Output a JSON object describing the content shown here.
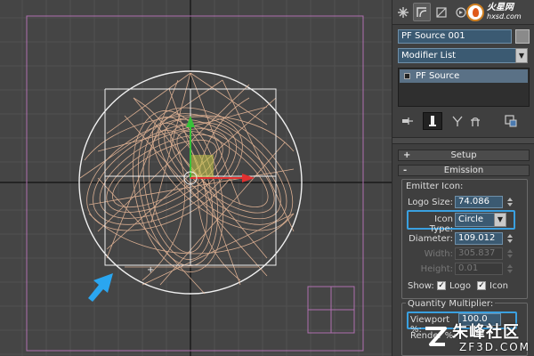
{
  "watermark_top": {
    "line1": "火星网",
    "line2": "hxsd.com"
  },
  "panel": {
    "tabs": [
      "create-icon",
      "modify-icon",
      "hierarchy-icon",
      "motion-icon",
      "display-icon",
      "utilities-icon"
    ],
    "object_name": "PF Source 001",
    "object_color": "#8a8a8a",
    "modifier_list_label": "Modifier List",
    "stack_items": [
      "PF Source"
    ],
    "stack_tools": [
      "pin-stack-icon",
      "show-end-result-icon",
      "make-unique-icon",
      "remove-modifier-icon",
      "configure-modifier-sets-icon"
    ]
  },
  "rollouts": {
    "setup": {
      "sign": "+",
      "label": "Setup"
    },
    "emission": {
      "sign": "-",
      "label": "Emission"
    }
  },
  "emission": {
    "emitter_icon_title": "Emitter Icon:",
    "logo_size_label": "Logo Size:",
    "logo_size_value": "74.086",
    "icon_type_label": "Icon Type:",
    "icon_type_value": "Circle",
    "diameter_label": "Diameter:",
    "diameter_value": "109.012",
    "width_label": "Width:",
    "width_value": "305.837",
    "height_label": "Height:",
    "height_value": "0.01",
    "show_label": "Show:",
    "show_logo_label": "Logo",
    "show_logo_checked": true,
    "show_icon_label": "Icon",
    "show_icon_checked": true,
    "quantity_title": "Quantity Multiplier:",
    "viewport_label": "Viewport %:",
    "viewport_value": "100.0",
    "render_label": "Render %:"
  },
  "watermark_bottom": {
    "line1": "朱峰社区",
    "line2": "ZF3D.COM"
  },
  "colors": {
    "wireframe": "#e8b898",
    "viewport_bg": "#454545",
    "field_bg": "#3b5a72",
    "highlight": "#3aa0e0",
    "selection_frame": "#b070b0"
  }
}
